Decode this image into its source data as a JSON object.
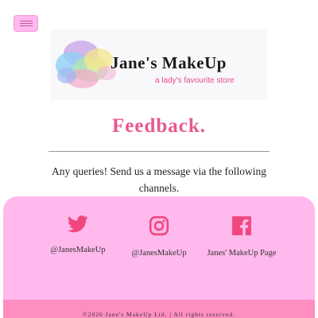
{
  "nav": {
    "menu_icon": "hamburger-menu-icon"
  },
  "logo": {
    "title": "Jane's MakeUp",
    "tagline": "a lady's favourite store"
  },
  "feedback": {
    "title": "Feedback.",
    "intro": "Any queries! Send us a message via the following channels."
  },
  "contacts": {
    "twitter": {
      "icon": "twitter-icon",
      "label": "@JanesMakeUp"
    },
    "instagram": {
      "icon": "instagram-icon",
      "label": "@JanesMakeUp"
    },
    "facebook": {
      "icon": "facebook-icon",
      "label": "Janes' MakeUp Page"
    }
  },
  "footer": {
    "copyright": "©2020 Jane's MakeUp Ltd. | All rights reserved."
  },
  "colors": {
    "accent_pink": "#e9578f",
    "panel_pink": "#ffb9ec",
    "footer_pink": "#ff8ec0",
    "icon_pink": "#f0477f"
  }
}
